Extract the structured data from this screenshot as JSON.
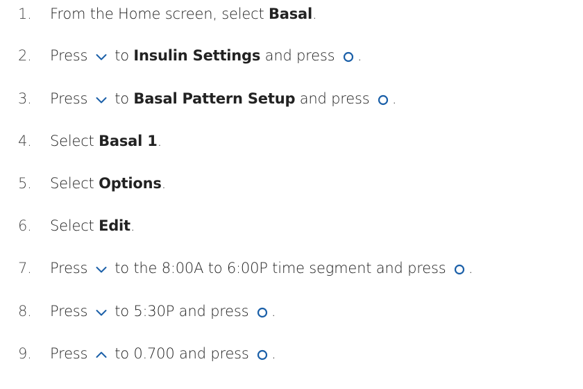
{
  "steps": [
    {
      "num": "1.",
      "parts": [
        {
          "t": "text",
          "v": "From the Home screen, select "
        },
        {
          "t": "bold",
          "v": "Basal"
        },
        {
          "t": "text",
          "v": "."
        }
      ]
    },
    {
      "num": "2.",
      "parts": [
        {
          "t": "text",
          "v": "Press "
        },
        {
          "t": "icon",
          "v": "down-arrow-icon"
        },
        {
          "t": "text",
          "v": " to "
        },
        {
          "t": "bold",
          "v": "Insulin Settings"
        },
        {
          "t": "text",
          "v": " and press "
        },
        {
          "t": "icon",
          "v": "select-button-icon"
        },
        {
          "t": "text",
          "v": "."
        }
      ]
    },
    {
      "num": "3.",
      "parts": [
        {
          "t": "text",
          "v": "Press "
        },
        {
          "t": "icon",
          "v": "down-arrow-icon"
        },
        {
          "t": "text",
          "v": " to "
        },
        {
          "t": "bold",
          "v": "Basal Pattern Setup"
        },
        {
          "t": "text",
          "v": " and press "
        },
        {
          "t": "icon",
          "v": "select-button-icon"
        },
        {
          "t": "text",
          "v": "."
        }
      ]
    },
    {
      "num": "4.",
      "parts": [
        {
          "t": "text",
          "v": "Select "
        },
        {
          "t": "bold",
          "v": "Basal 1"
        },
        {
          "t": "text",
          "v": "."
        }
      ]
    },
    {
      "num": "5.",
      "parts": [
        {
          "t": "text",
          "v": "Select "
        },
        {
          "t": "bold",
          "v": "Options"
        },
        {
          "t": "text",
          "v": "."
        }
      ]
    },
    {
      "num": "6.",
      "parts": [
        {
          "t": "text",
          "v": "Select "
        },
        {
          "t": "bold",
          "v": "Edit"
        },
        {
          "t": "text",
          "v": "."
        }
      ]
    },
    {
      "num": "7.",
      "parts": [
        {
          "t": "text",
          "v": "Press "
        },
        {
          "t": "icon",
          "v": "down-arrow-icon"
        },
        {
          "t": "text",
          "v": " to the 8:00A to 6:00P time segment and press "
        },
        {
          "t": "icon",
          "v": "select-button-icon"
        },
        {
          "t": "text",
          "v": "."
        }
      ]
    },
    {
      "num": "8.",
      "parts": [
        {
          "t": "text",
          "v": "Press "
        },
        {
          "t": "icon",
          "v": "down-arrow-icon"
        },
        {
          "t": "text",
          "v": " to 5:30P and press "
        },
        {
          "t": "icon",
          "v": "select-button-icon"
        },
        {
          "t": "text",
          "v": "."
        }
      ]
    },
    {
      "num": "9.",
      "parts": [
        {
          "t": "text",
          "v": "Press "
        },
        {
          "t": "icon",
          "v": "up-arrow-icon"
        },
        {
          "t": "text",
          "v": " to 0.700 and press "
        },
        {
          "t": "icon",
          "v": "select-button-icon"
        },
        {
          "t": "text",
          "v": "."
        }
      ]
    }
  ],
  "colors": {
    "text": "#222222",
    "number": "#444444",
    "icon": "#1a5fa8"
  }
}
